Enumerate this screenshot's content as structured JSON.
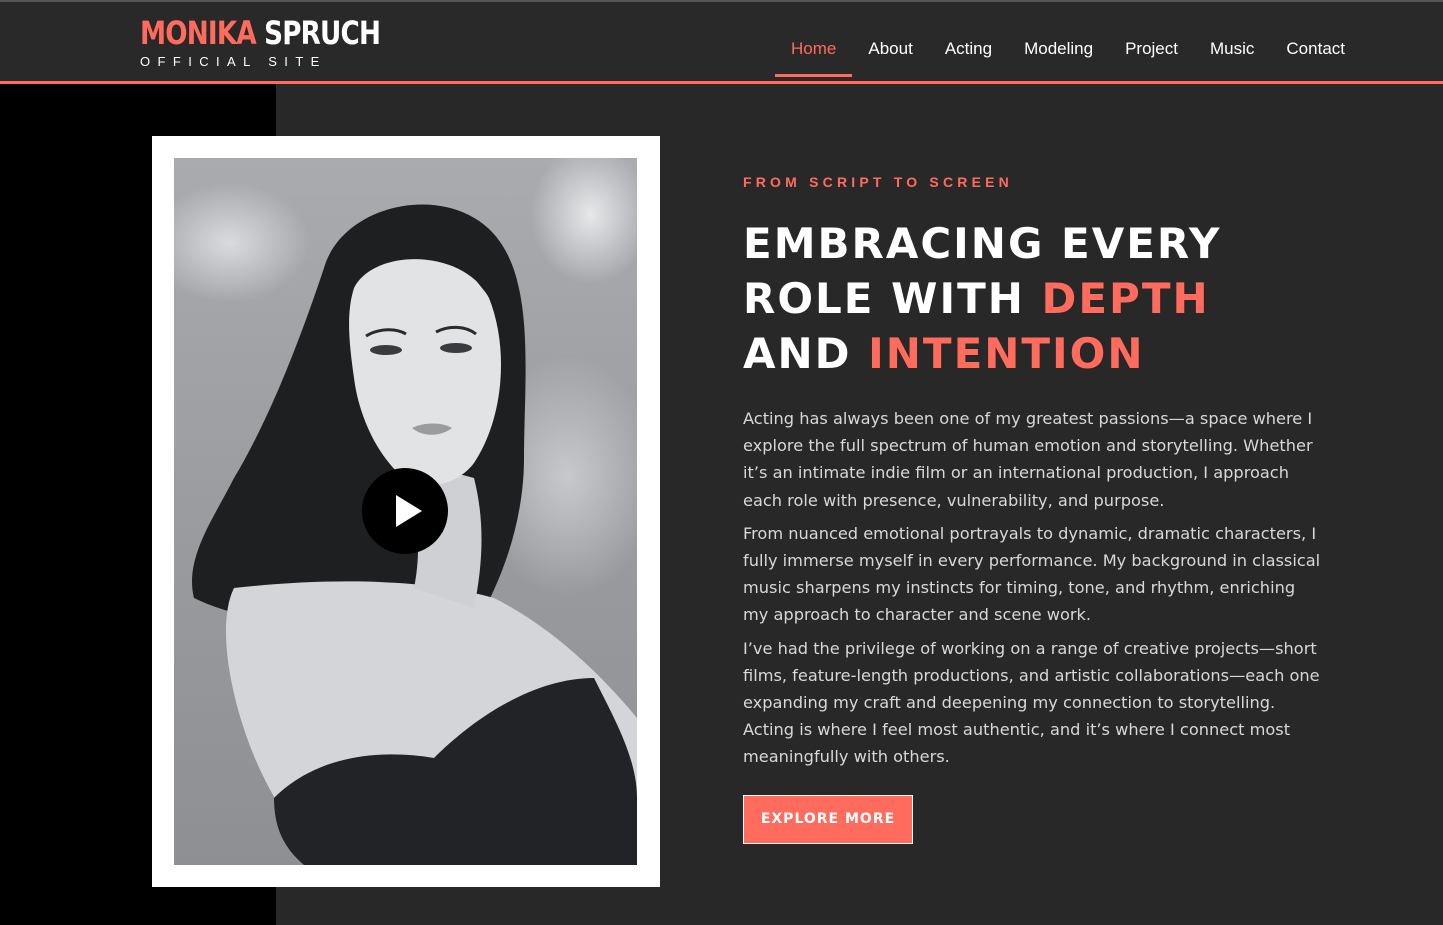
{
  "brand": {
    "first_name": "MONIKA",
    "last_name": "SPRUCH",
    "subtitle": "OFFICIAL SITE",
    "accent_color": "#ff6b5d"
  },
  "nav": {
    "items": [
      {
        "label": "Home",
        "active": true
      },
      {
        "label": "About",
        "active": false
      },
      {
        "label": "Acting",
        "active": false
      },
      {
        "label": "Modeling",
        "active": false
      },
      {
        "label": "Project",
        "active": false
      },
      {
        "label": "Music",
        "active": false
      },
      {
        "label": "Contact",
        "active": false
      }
    ]
  },
  "hero": {
    "video_thumbnail": "black-and-white portrait photo",
    "play_icon": "play-icon"
  },
  "content": {
    "eyebrow": "FROM SCRIPT TO SCREEN",
    "headline": {
      "line1": "EMBRACING EVERY",
      "line2_white": "ROLE WITH ",
      "line2_accent": "DEPTH",
      "line3_white": "AND ",
      "line3_accent": "INTENTION"
    },
    "paragraphs": [
      "Acting has always been one of my greatest passions—a space where I explore the full spectrum of human emotion and storytelling. Whether it’s an intimate indie film or an international production, I approach each role with presence, vulnerability, and purpose.",
      "From nuanced emotional portrayals to dynamic, dramatic characters, I fully immerse myself in every performance. My background in classical music sharpens my instincts for timing, tone, and rhythm, enriching my approach to character and scene work.",
      "I’ve had the privilege of working on a range of creative projects—short films, feature-length productions, and artistic collaborations—each one expanding my craft and deepening my connection to storytelling. Acting is where I feel most authentic, and it’s where I connect most meaningfully with others."
    ],
    "button_label": "EXPLORE MORE"
  }
}
